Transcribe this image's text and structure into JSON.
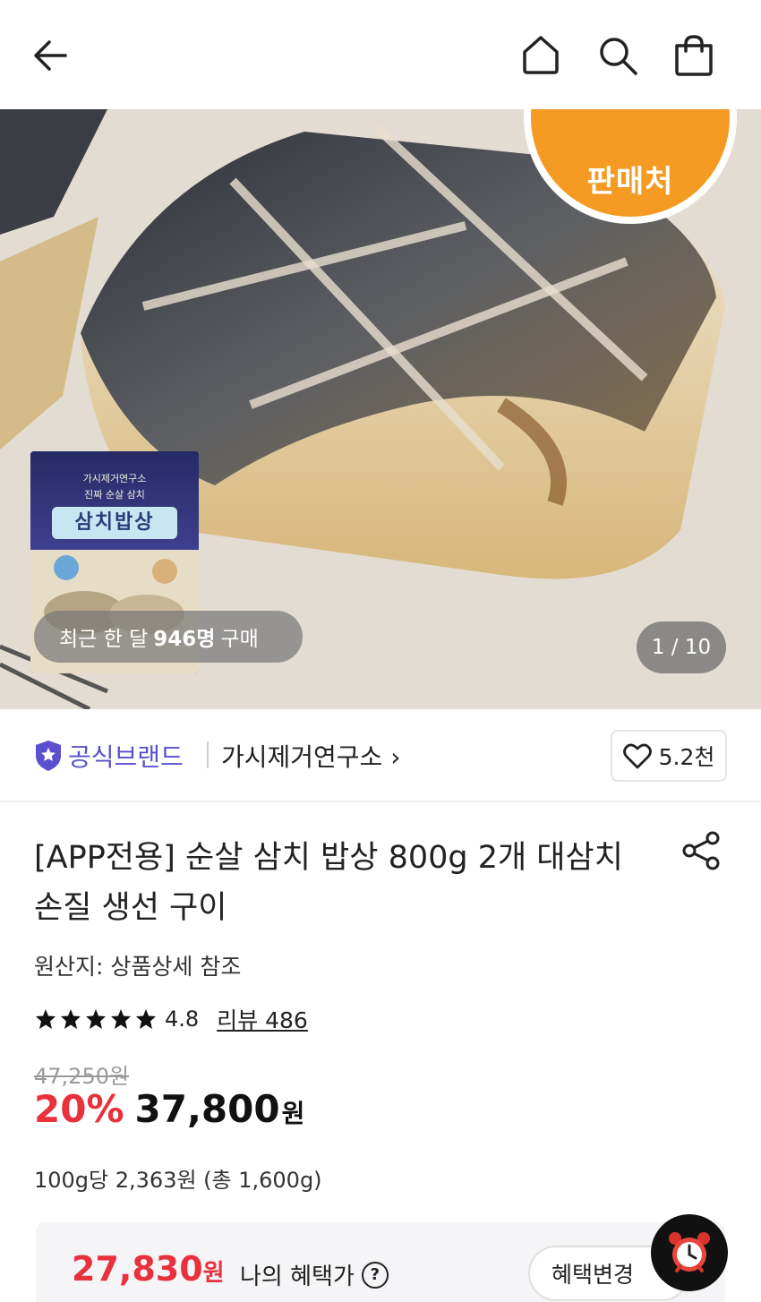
{
  "header": {
    "back_icon": "arrow-left-icon",
    "home_icon": "home-icon",
    "search_icon": "search-icon",
    "cart_icon": "shopping-bag-icon"
  },
  "hero": {
    "seller_badge": "판매처",
    "package_brand": "가시제거연구소",
    "package_subtitle": "진짜 순살 삼치",
    "package_title": "삼치밥상",
    "recent_prefix": "최근 한 달",
    "recent_count": "946명",
    "recent_suffix": "구매",
    "image_counter": "1 / 10"
  },
  "brand": {
    "official_label": "공식브랜드",
    "brand_name": "가시제거연구소 ›",
    "like_count": "5.2천",
    "official_color": "#5a4fcf"
  },
  "product": {
    "title": "[APP전용] 순살 삼치 밥상 800g 2개 대삼치 손질 생선 구이",
    "origin": "원산지: 상품상세 참조",
    "rating_score": "4.8",
    "rating_value": 4.8,
    "review_link": "리뷰 486",
    "original_price": "47,250원",
    "discount": "20%",
    "price": "37,800",
    "price_unit": "원",
    "unit_price": "100g당 2,363원 (총 1,600g)"
  },
  "benefit": {
    "price": "27,830",
    "price_unit": "원",
    "label": "나의 혜택가",
    "help_icon": "?",
    "change_button": "혜택변경",
    "accent_color": "#e8313d"
  },
  "fab": {
    "icon": "alarm-clock-icon"
  }
}
